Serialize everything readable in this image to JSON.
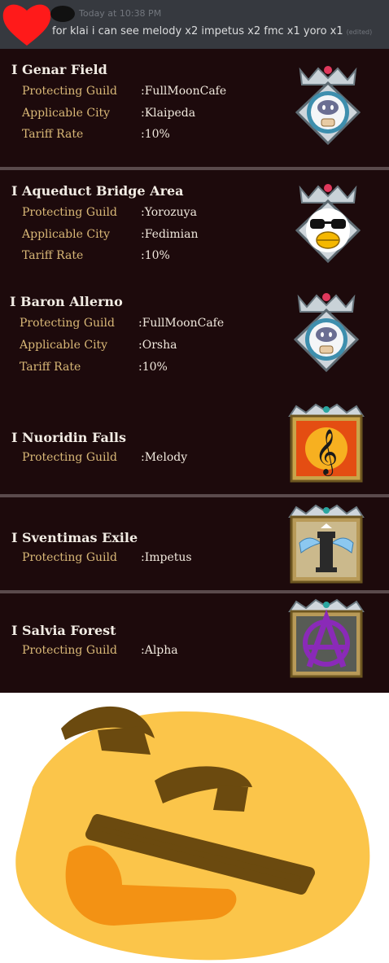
{
  "message": {
    "timestamp": "Today at 10:38 PM",
    "text": "for klai i can see melody x2 impetus x2 fmc x1 yoro x1",
    "edited": "(edited)"
  },
  "labels": {
    "protecting_guild": "Protecting Guild",
    "applicable_city": "Applicable City",
    "tariff_rate": "Tariff Rate",
    "colon": ":"
  },
  "territories": [
    {
      "name": "I Genar Field",
      "guild": "FullMoonCafe",
      "city": "Klaipeda",
      "tariff": "10%",
      "emblem": "fullmooncafe-emblem-icon"
    },
    {
      "name": "I Aqueduct Bridge Area",
      "guild": "Yorozuya",
      "city": "Fedimian",
      "tariff": "10%",
      "emblem": "yorozuya-penguin-emblem-icon"
    },
    {
      "name": "I Baron Allerno",
      "guild": "FullMoonCafe",
      "city": "Orsha",
      "tariff": "10%",
      "emblem": "fullmooncafe-emblem-icon"
    },
    {
      "name": "I Nuoridin Falls",
      "guild": "Melody",
      "emblem": "melody-treble-clef-emblem-icon"
    },
    {
      "name": "I Sventimas Exile",
      "guild": "Impetus",
      "emblem": "impetus-winged-tower-emblem-icon"
    },
    {
      "name": "I Salvia Forest",
      "guild": "Alpha",
      "emblem": "alpha-anarchy-emblem-icon"
    }
  ],
  "colors": {
    "discord_bg": "#36393f",
    "panel_bg": "#1d0a0c",
    "label_gold": "#d9b877",
    "value_white": "#f0e8dd",
    "thinking_yellow": "#fbc54a",
    "brow_brown": "#6b4a0f",
    "hand_orange": "#f39214"
  }
}
